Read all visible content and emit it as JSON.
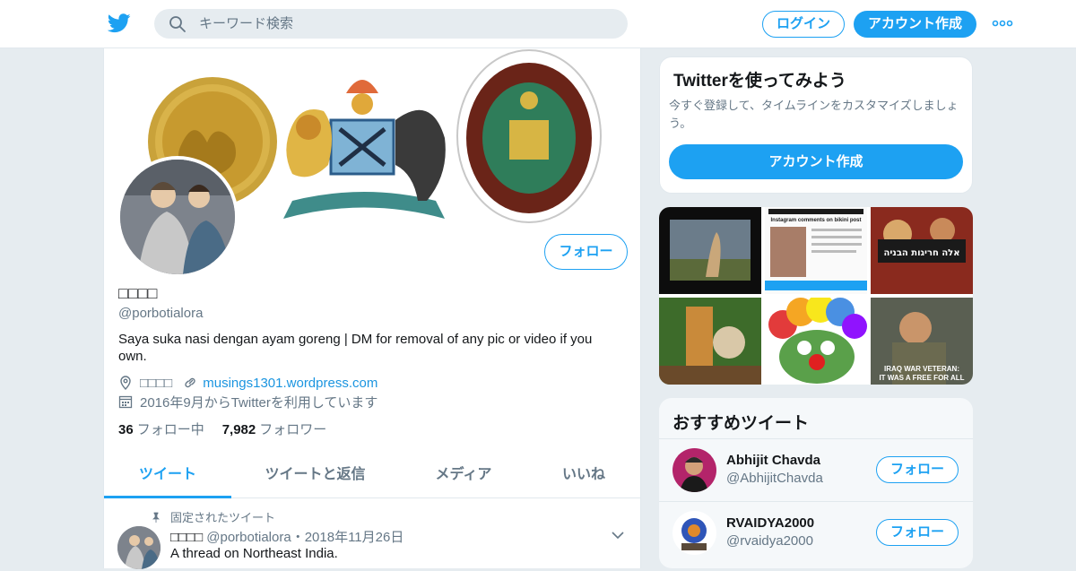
{
  "header": {
    "search_placeholder": "キーワード検索",
    "login_label": "ログイン",
    "signup_label": "アカウント作成",
    "brand_color": "#1da1f2"
  },
  "profile": {
    "display_name": "□□□□",
    "handle": "@porbotialora",
    "follow_label": "フォロー",
    "bio": "Saya suka nasi dengan ayam goreng | DM for removal of any pic or video if you own.",
    "location": "□□□□",
    "url": "musings1301.wordpress.com",
    "joined": "2016年9月からTwitterを利用しています",
    "following_count": "36",
    "following_label": "フォロー中",
    "followers_count": "7,982",
    "followers_label": "フォロワー"
  },
  "tabs": [
    {
      "label": "ツイート",
      "active": true
    },
    {
      "label": "ツイートと返信",
      "active": false
    },
    {
      "label": "メディア",
      "active": false
    },
    {
      "label": "いいね",
      "active": false
    }
  ],
  "pinned_tweet": {
    "pinned_label": "固定されたツイート",
    "author_name": "□□□□",
    "author_handle": "@porbotialora",
    "date": "・2018年11月26日",
    "text": "A thread on Northeast India."
  },
  "signup_card": {
    "title": "Twitterを使ってみよう",
    "description": "今すぐ登録して、タイムラインをカスタマイズしましょう。",
    "button_label": "アカウント作成"
  },
  "media_tiles": [
    {
      "overlay": ""
    },
    {
      "overlay": "Instagram comments on bikini post"
    },
    {
      "overlay": "אלה חריגות הבניה"
    },
    {
      "overlay": ""
    },
    {
      "overlay": ""
    },
    {
      "overlay": "IRAQ WAR VETERAN: IT WAS A FREE FOR ALL"
    }
  ],
  "recommended": {
    "title": "おすすめツイート",
    "users": [
      {
        "name": "Abhijit Chavda",
        "handle": "@AbhijitChavda",
        "follow_label": "フォロー"
      },
      {
        "name": "RVAIDYA2000",
        "handle": "@rvaidya2000",
        "follow_label": "フォロー"
      }
    ]
  }
}
